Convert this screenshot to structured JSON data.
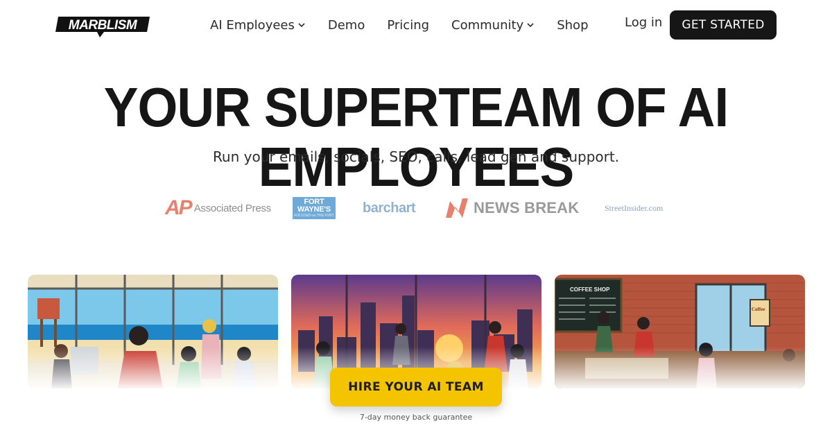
{
  "brand": {
    "name": "MARBLISM"
  },
  "nav": {
    "items": [
      {
        "label": "AI Employees",
        "dropdown": true
      },
      {
        "label": "Demo",
        "dropdown": false
      },
      {
        "label": "Pricing",
        "dropdown": false
      },
      {
        "label": "Community",
        "dropdown": true
      },
      {
        "label": "Shop",
        "dropdown": false
      }
    ],
    "login": "Log in",
    "cta": "GET STARTED"
  },
  "hero": {
    "title": "YOUR SUPERTEAM OF AI EMPLOYEES",
    "subtitle": "Run your emails, socials, SEO, calls, lead gen and support."
  },
  "press": {
    "ap_mark": "AP",
    "ap_name": "Associated Press",
    "fortwayne_line1": "FORT",
    "fortwayne_line2": "WAYNE'S",
    "fortwayne_tagline": "FOCUSED on THE FORT",
    "barchart": "barchart",
    "newsbreak": "NEWS BREAK",
    "streetinsider": "StreetInsider.com"
  },
  "scenes": {
    "coffee_sign": "COFFEE SHOP",
    "coffee_poster": "Coffee"
  },
  "cta": {
    "hire": "HIRE YOUR AI TEAM",
    "guarantee": "7-day money back guarantee"
  },
  "colors": {
    "primary_dark": "#161616",
    "accent_yellow": "#f5c400"
  }
}
